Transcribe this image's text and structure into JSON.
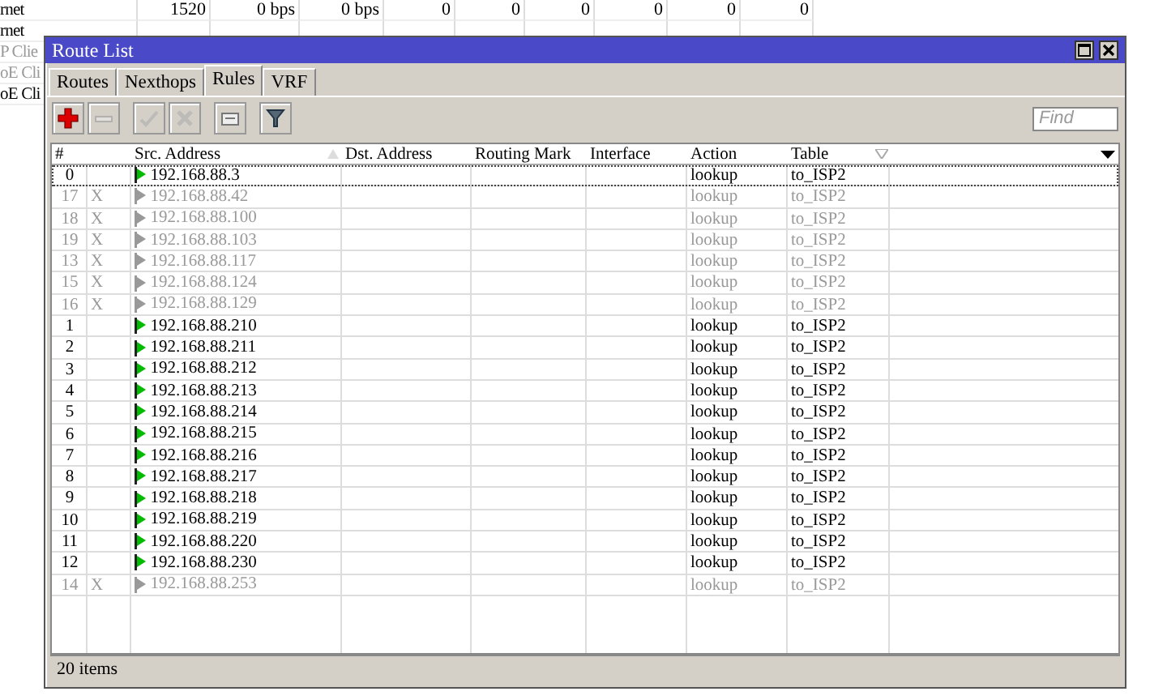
{
  "background_table": {
    "rows": [
      {
        "cells": [
          "rnet",
          "1520",
          "0 bps",
          "0 bps",
          "0",
          "0",
          "0",
          "0",
          "0",
          "0"
        ],
        "dimmed": false
      },
      {
        "cells": [
          "rnet"
        ],
        "dimmed": false
      },
      {
        "cells": [
          "P Clie"
        ],
        "dimmed": true
      },
      {
        "cells": [
          "oE Cli"
        ],
        "dimmed": true
      },
      {
        "cells": [
          "oE Cli"
        ],
        "dimmed": false
      }
    ]
  },
  "window": {
    "title": "Route List",
    "tabs": [
      {
        "label": "Routes",
        "selected": false
      },
      {
        "label": "Nexthops",
        "selected": false
      },
      {
        "label": "Rules",
        "selected": true
      },
      {
        "label": "VRF",
        "selected": false
      }
    ],
    "toolbar": [
      {
        "kind": "add",
        "disabled": false
      },
      {
        "kind": "remove",
        "disabled": true
      },
      {
        "kind": "enable",
        "disabled": true
      },
      {
        "kind": "disable",
        "disabled": true
      },
      {
        "kind": "comment",
        "disabled": false
      },
      {
        "kind": "filter",
        "disabled": false
      }
    ],
    "search": {
      "placeholder": "Find"
    },
    "table": {
      "columns": [
        {
          "label": "#"
        },
        {},
        {
          "label": "Src. Address",
          "sorted": true
        },
        {
          "label": "Dst. Address"
        },
        {
          "label": "Routing Mark"
        },
        {
          "label": "Interface"
        },
        {
          "label": "Action"
        },
        {
          "label": "Table",
          "filtered": true
        }
      ],
      "rows": [
        {
          "number": "0",
          "disabled": false,
          "selected": true,
          "src": "192.168.88.3",
          "action": "lookup",
          "table": "to_ISP2"
        },
        {
          "number": "17",
          "disabled": true,
          "selected": false,
          "flag": "X",
          "src": "192.168.88.42",
          "action": "lookup",
          "table": "to_ISP2"
        },
        {
          "number": "18",
          "disabled": true,
          "selected": false,
          "flag": "X",
          "src": "192.168.88.100",
          "action": "lookup",
          "table": "to_ISP2"
        },
        {
          "number": "19",
          "disabled": true,
          "selected": false,
          "flag": "X",
          "src": "192.168.88.103",
          "action": "lookup",
          "table": "to_ISP2"
        },
        {
          "number": "13",
          "disabled": true,
          "selected": false,
          "flag": "X",
          "src": "192.168.88.117",
          "action": "lookup",
          "table": "to_ISP2"
        },
        {
          "number": "15",
          "disabled": true,
          "selected": false,
          "flag": "X",
          "src": "192.168.88.124",
          "action": "lookup",
          "table": "to_ISP2"
        },
        {
          "number": "16",
          "disabled": true,
          "selected": false,
          "flag": "X",
          "src": "192.168.88.129",
          "action": "lookup",
          "table": "to_ISP2"
        },
        {
          "number": "1",
          "disabled": false,
          "selected": false,
          "src": "192.168.88.210",
          "action": "lookup",
          "table": "to_ISP2"
        },
        {
          "number": "2",
          "disabled": false,
          "selected": false,
          "src": "192.168.88.211",
          "action": "lookup",
          "table": "to_ISP2"
        },
        {
          "number": "3",
          "disabled": false,
          "selected": false,
          "src": "192.168.88.212",
          "action": "lookup",
          "table": "to_ISP2"
        },
        {
          "number": "4",
          "disabled": false,
          "selected": false,
          "src": "192.168.88.213",
          "action": "lookup",
          "table": "to_ISP2"
        },
        {
          "number": "5",
          "disabled": false,
          "selected": false,
          "src": "192.168.88.214",
          "action": "lookup",
          "table": "to_ISP2"
        },
        {
          "number": "6",
          "disabled": false,
          "selected": false,
          "src": "192.168.88.215",
          "action": "lookup",
          "table": "to_ISP2"
        },
        {
          "number": "7",
          "disabled": false,
          "selected": false,
          "src": "192.168.88.216",
          "action": "lookup",
          "table": "to_ISP2"
        },
        {
          "number": "8",
          "disabled": false,
          "selected": false,
          "src": "192.168.88.217",
          "action": "lookup",
          "table": "to_ISP2"
        },
        {
          "number": "9",
          "disabled": false,
          "selected": false,
          "src": "192.168.88.218",
          "action": "lookup",
          "table": "to_ISP2"
        },
        {
          "number": "10",
          "disabled": false,
          "selected": false,
          "src": "192.168.88.219",
          "action": "lookup",
          "table": "to_ISP2"
        },
        {
          "number": "11",
          "disabled": false,
          "selected": false,
          "src": "192.168.88.220",
          "action": "lookup",
          "table": "to_ISP2"
        },
        {
          "number": "12",
          "disabled": false,
          "selected": false,
          "src": "192.168.88.230",
          "action": "lookup",
          "table": "to_ISP2"
        },
        {
          "number": "14",
          "disabled": true,
          "selected": false,
          "flag": "X",
          "src": "192.168.88.253",
          "action": "lookup",
          "table": "to_ISP2"
        }
      ]
    },
    "status_bar": "20 items"
  }
}
